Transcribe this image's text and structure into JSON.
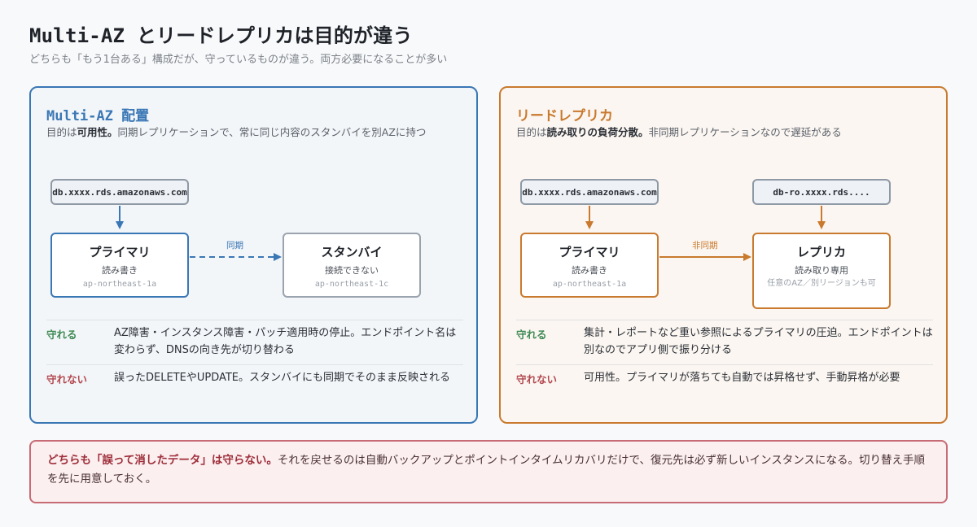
{
  "header": {
    "title": "Multi-AZ とリードレプリカは目的が違う",
    "subtitle": "どちらも「もう1台ある」構成だが、守っているものが違う。両方必要になることが多い"
  },
  "colors": {
    "multi_az_accent": "#3a77b5",
    "replica_accent": "#c97a2e",
    "protected_label": "#3f8a55",
    "not_protected_label": "#b2484f",
    "callout_border": "#c76b74"
  },
  "multi_az": {
    "title": "Multi-AZ 配置",
    "desc_prefix": "目的は",
    "desc_bold": "可用性。",
    "desc_rest": "同期レプリケーションで、常に同じ内容のスタンバイを別AZに持つ",
    "endpoint": "db.xxxx.rds.amazonaws.com",
    "primary": {
      "name": "プライマリ",
      "role": "読み書き",
      "az": "ap-northeast-1a"
    },
    "standby": {
      "name": "スタンバイ",
      "role": "接続できない",
      "az": "ap-northeast-1c"
    },
    "edge_label": "同期",
    "protects_label": "守れる",
    "protects_text": "AZ障害・インスタンス障害・パッチ適用時の停止。エンドポイント名は変わらず、DNSの向き先が切り替わる",
    "not_protects_label": "守れない",
    "not_protects_text": "誤ったDELETEやUPDATE。スタンバイにも同期でそのまま反映される"
  },
  "read_replica": {
    "title": "リードレプリカ",
    "desc_prefix": "目的は",
    "desc_bold": "読み取りの負荷分散。",
    "desc_rest": "非同期レプリケーションなので遅延がある",
    "endpoint_primary": "db.xxxx.rds.amazonaws.com",
    "endpoint_replica": "db-ro.xxxx.rds....",
    "primary": {
      "name": "プライマリ",
      "role": "読み書き",
      "az": "ap-northeast-1a"
    },
    "replica": {
      "name": "レプリカ",
      "role": "読み取り専用",
      "az": "任意のAZ／別リージョンも可"
    },
    "edge_label": "非同期",
    "protects_label": "守れる",
    "protects_text": "集計・レポートなど重い参照によるプライマリの圧迫。エンドポイントは別なのでアプリ側で振り分ける",
    "not_protects_label": "守れない",
    "not_protects_text": "可用性。プライマリが落ちても自動では昇格せず、手動昇格が必要"
  },
  "callout": {
    "bold": "どちらも「誤って消したデータ」は守らない。",
    "text": "それを戻せるのは自動バックアップとポイントインタイムリカバリだけで、復元先は必ず新しいインスタンスになる。切り替え手順を先に用意しておく。"
  }
}
